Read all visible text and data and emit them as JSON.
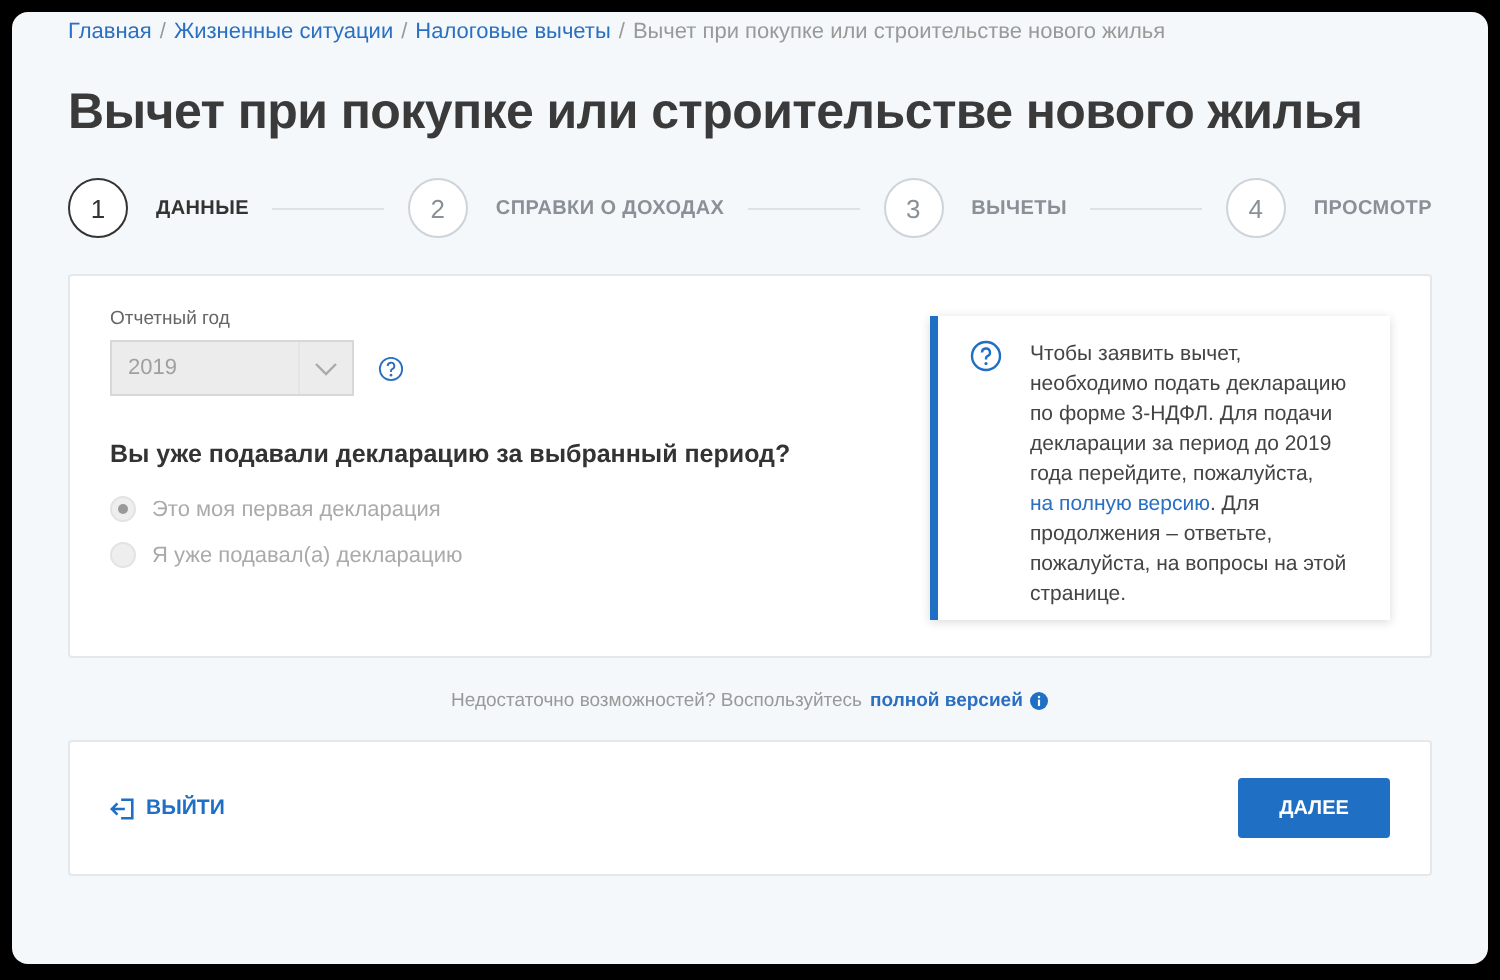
{
  "breadcrumbs": [
    {
      "label": "Главная",
      "kind": "link"
    },
    {
      "label": "/",
      "kind": "separator"
    },
    {
      "label": "Жизненные ситуации",
      "kind": "link"
    },
    {
      "label": "/",
      "kind": "separator"
    },
    {
      "label": "Налоговые вычеты",
      "kind": "link"
    },
    {
      "label": "/",
      "kind": "separator"
    },
    {
      "label": "Вычет при покупке или строительстве нового жилья",
      "kind": "current"
    }
  ],
  "title": "Вычет при покупке или строительстве нового жилья",
  "steps": [
    {
      "number": "1",
      "label": "ДАННЫЕ",
      "selected": true
    },
    {
      "number": "2",
      "label": "СПРАВКИ О ДОХОДАХ",
      "selected": false
    },
    {
      "number": "3",
      "label": "ВЫЧЕТЫ",
      "selected": false
    },
    {
      "number": "4",
      "label": "ПРОСМОТР",
      "selected": false
    }
  ],
  "form": {
    "year_label": "Отчетный год",
    "year_value": "2019",
    "year_disabled": true,
    "question": "Вы уже подавали декларацию за выбранный период?",
    "options": [
      {
        "label": "Это моя первая декларация",
        "selected": true,
        "disabled": true
      },
      {
        "label": "Я уже подавал(а) декларацию",
        "selected": false,
        "disabled": true
      }
    ]
  },
  "info": {
    "text_before": "Чтобы заявить вычет, необходимо подать декларацию по форме 3-НДФЛ. Для подачи декларации за период до 2019 года перейдите, пожалуйста,",
    "link": "на полную версию",
    "text_after": ". Для продолжения – ответьте, пожалуйста, на вопросы на этой странице."
  },
  "note": {
    "text": "Недостаточно возможностей? Воспользуйтесь",
    "link": "полной версией"
  },
  "footer": {
    "exit": "ВЫЙТИ",
    "next": "ДАЛЕЕ"
  }
}
